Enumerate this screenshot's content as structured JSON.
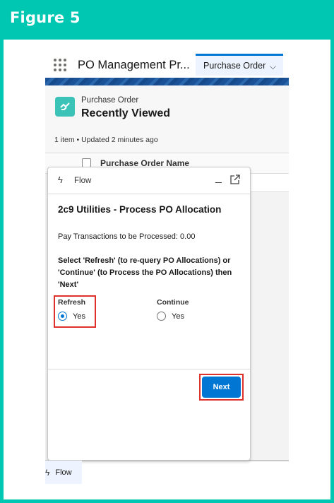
{
  "figure": {
    "title": "Figure 5"
  },
  "app": {
    "name": "PO Management Pr...",
    "nav_tab": "Purchase Order"
  },
  "list": {
    "object_label": "Purchase Order",
    "title": "Recently Viewed",
    "meta": "1 item • Updated 2 minutes ago",
    "column_header": "Purchase Order Name"
  },
  "flow": {
    "header_label": "Flow",
    "title": "2c9 Utilities - Process PO Allocation",
    "pay_text": "Pay Transactions to be Processed: 0.00",
    "instructions": "Select 'Refresh' (to re-query PO Allocations) or 'Continue' (to Process the PO Allocations) then 'Next'",
    "refresh_group": {
      "label": "Refresh",
      "option": "Yes",
      "selected": true
    },
    "continue_group": {
      "label": "Continue",
      "option": "Yes",
      "selected": false
    },
    "next_label": "Next"
  },
  "utility": {
    "label": "Flow"
  },
  "colors": {
    "brand_teal": "#00c7b1",
    "accent_blue": "#0176d3",
    "highlight_red": "#e0302b"
  }
}
